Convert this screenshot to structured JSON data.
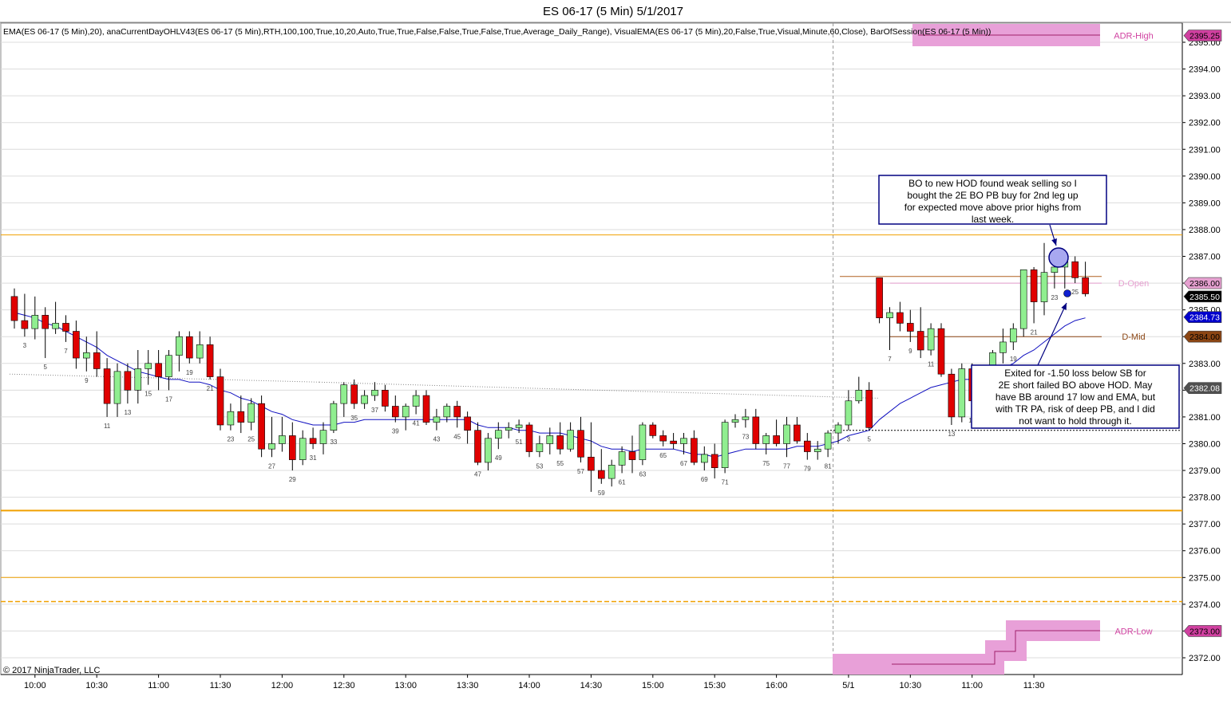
{
  "chart_data": {
    "type": "candlestick",
    "title": "ES 06-17 (5 Min)  5/1/2017",
    "indicator_line": "EMA(ES 06-17 (5 Min),20), anaCurrentDayOHLV43(ES 06-17 (5 Min),RTH,100,100,True,10,20,Auto,True,True,False,False,True,False,True,Average_Daily_Range), VisualEMA(ES 06-17 (5 Min),20,False,True,Visual,Minute,60,Close), BarOfSession(ES 06-17 (5 Min))",
    "copyright": "© 2017 NinjaTrader, LLC",
    "ylim": [
      2371.4,
      2395.5
    ],
    "y_ticks": [
      "2372.00",
      "2373.00",
      "2374.00",
      "2375.00",
      "2376.00",
      "2377.00",
      "2378.00",
      "2379.00",
      "2380.00",
      "2381.00",
      "2382.00",
      "2383.00",
      "2384.00",
      "2385.00",
      "2386.00",
      "2387.00",
      "2388.00",
      "2389.00",
      "2390.00",
      "2391.00",
      "2392.00",
      "2393.00",
      "2394.00",
      "2395.00"
    ],
    "x_ticks": [
      "10:00",
      "10:30",
      "11:00",
      "11:30",
      "12:00",
      "12:30",
      "13:00",
      "13:30",
      "14:00",
      "14:30",
      "15:00",
      "15:30",
      "16:00",
      "5/1",
      "10:30",
      "11:00",
      "11:30"
    ],
    "x_tick_bars": [
      2,
      8,
      14,
      20,
      26,
      32,
      38,
      44,
      50,
      56,
      62,
      68,
      74,
      81,
      87,
      93,
      99
    ],
    "session_break_bar": 79.5,
    "bar_count": 105,
    "candles": [
      [
        2385.5,
        2385.8,
        2384.3,
        2384.6
      ],
      [
        2384.6,
        2385.6,
        2384.0,
        2384.3
      ],
      [
        2384.3,
        2385.5,
        2383.9,
        2384.8
      ],
      [
        2384.8,
        2385.1,
        2383.2,
        2384.3
      ],
      [
        2384.3,
        2385.3,
        2384.1,
        2384.5
      ],
      [
        2384.5,
        2384.8,
        2383.8,
        2384.2
      ],
      [
        2384.2,
        2384.6,
        2382.8,
        2383.2
      ],
      [
        2383.2,
        2384.0,
        2382.7,
        2383.4
      ],
      [
        2383.4,
        2384.2,
        2382.5,
        2382.8
      ],
      [
        2382.8,
        2383.2,
        2381.0,
        2381.5
      ],
      [
        2381.5,
        2383.0,
        2381.0,
        2382.7
      ],
      [
        2382.7,
        2383.0,
        2381.5,
        2382.0
      ],
      [
        2382.0,
        2383.5,
        2381.5,
        2382.8
      ],
      [
        2382.8,
        2383.5,
        2382.2,
        2383.0
      ],
      [
        2383.0,
        2383.5,
        2382.0,
        2382.5
      ],
      [
        2382.5,
        2383.5,
        2382.0,
        2383.3
      ],
      [
        2383.3,
        2384.2,
        2382.7,
        2384.0
      ],
      [
        2384.0,
        2384.2,
        2383.0,
        2383.2
      ],
      [
        2383.2,
        2384.2,
        2383.0,
        2383.7
      ],
      [
        2383.7,
        2384.0,
        2382.4,
        2382.5
      ],
      [
        2382.5,
        2382.8,
        2380.5,
        2380.7
      ],
      [
        2380.7,
        2381.5,
        2380.5,
        2381.2
      ],
      [
        2381.2,
        2381.8,
        2380.4,
        2380.8
      ],
      [
        2380.8,
        2381.7,
        2380.5,
        2381.5
      ],
      [
        2381.5,
        2381.8,
        2379.5,
        2379.8
      ],
      [
        2379.8,
        2381.0,
        2379.5,
        2380.0
      ],
      [
        2380.0,
        2381.0,
        2379.7,
        2380.3
      ],
      [
        2380.3,
        2380.8,
        2379.0,
        2379.4
      ],
      [
        2379.4,
        2380.5,
        2379.2,
        2380.2
      ],
      [
        2380.2,
        2380.6,
        2379.8,
        2380.0
      ],
      [
        2380.0,
        2380.8,
        2379.6,
        2380.5
      ],
      [
        2380.5,
        2381.6,
        2380.4,
        2381.5
      ],
      [
        2381.5,
        2382.3,
        2381.0,
        2382.2
      ],
      [
        2382.2,
        2382.4,
        2381.3,
        2381.5
      ],
      [
        2381.5,
        2382.0,
        2381.3,
        2381.8
      ],
      [
        2381.8,
        2382.3,
        2381.6,
        2382.0
      ],
      [
        2382.0,
        2382.2,
        2381.2,
        2381.4
      ],
      [
        2381.4,
        2381.8,
        2380.8,
        2381.0
      ],
      [
        2381.0,
        2381.5,
        2380.5,
        2381.4
      ],
      [
        2381.4,
        2382.0,
        2381.1,
        2381.8
      ],
      [
        2381.8,
        2382.0,
        2380.7,
        2380.8
      ],
      [
        2380.8,
        2381.3,
        2380.5,
        2381.0
      ],
      [
        2381.0,
        2381.5,
        2380.8,
        2381.4
      ],
      [
        2381.4,
        2381.6,
        2380.6,
        2381.0
      ],
      [
        2381.0,
        2381.2,
        2380.0,
        2380.5
      ],
      [
        2380.5,
        2380.8,
        2379.2,
        2379.3
      ],
      [
        2379.3,
        2380.4,
        2379.0,
        2380.2
      ],
      [
        2380.2,
        2380.8,
        2379.8,
        2380.5
      ],
      [
        2380.5,
        2380.8,
        2380.2,
        2380.6
      ],
      [
        2380.6,
        2380.9,
        2380.4,
        2380.7
      ],
      [
        2380.7,
        2380.8,
        2379.5,
        2379.7
      ],
      [
        2379.7,
        2380.3,
        2379.5,
        2380.0
      ],
      [
        2380.0,
        2380.6,
        2379.6,
        2380.3
      ],
      [
        2380.3,
        2380.8,
        2379.6,
        2379.8
      ],
      [
        2379.8,
        2380.8,
        2379.7,
        2380.5
      ],
      [
        2380.5,
        2381.0,
        2379.3,
        2379.5
      ],
      [
        2379.5,
        2380.8,
        2378.2,
        2379.0
      ],
      [
        2379.0,
        2379.8,
        2378.5,
        2378.7
      ],
      [
        2378.7,
        2379.4,
        2378.4,
        2379.2
      ],
      [
        2379.2,
        2379.9,
        2378.9,
        2379.7
      ],
      [
        2379.7,
        2380.3,
        2378.9,
        2379.4
      ],
      [
        2379.4,
        2380.8,
        2379.2,
        2380.7
      ],
      [
        2380.7,
        2380.8,
        2380.2,
        2380.3
      ],
      [
        2380.3,
        2380.5,
        2379.9,
        2380.1
      ],
      [
        2380.1,
        2380.4,
        2379.8,
        2380.0
      ],
      [
        2380.0,
        2380.4,
        2379.6,
        2380.2
      ],
      [
        2380.2,
        2380.5,
        2379.2,
        2379.3
      ],
      [
        2379.3,
        2379.9,
        2379.0,
        2379.6
      ],
      [
        2379.6,
        2380.0,
        2378.7,
        2379.1
      ],
      [
        2379.1,
        2380.9,
        2378.9,
        2380.8
      ],
      [
        2380.8,
        2381.1,
        2380.6,
        2380.9
      ],
      [
        2380.9,
        2381.3,
        2380.6,
        2381.0
      ],
      [
        2381.0,
        2381.3,
        2379.8,
        2380.0
      ],
      [
        2380.0,
        2380.4,
        2379.6,
        2380.3
      ],
      [
        2380.3,
        2380.9,
        2379.9,
        2380.0
      ],
      [
        2380.0,
        2381.0,
        2379.5,
        2380.7
      ],
      [
        2380.7,
        2381.0,
        2380.0,
        2380.1
      ],
      [
        2380.1,
        2380.4,
        2379.4,
        2379.7
      ],
      [
        2379.7,
        2380.1,
        2379.4,
        2379.8
      ],
      [
        2379.8,
        2380.5,
        2379.5,
        2380.4
      ],
      [
        2380.4,
        2380.8,
        2380.0,
        2380.7
      ],
      [
        2380.7,
        2382.0,
        2380.5,
        2381.6
      ],
      [
        2381.6,
        2382.5,
        2381.5,
        2382.0
      ],
      [
        2382.0,
        2382.3,
        2380.5,
        2380.6
      ],
      [
        2386.2,
        2386.2,
        2384.5,
        2384.7
      ],
      [
        2384.7,
        2385.1,
        2383.5,
        2384.9
      ],
      [
        2384.9,
        2385.3,
        2384.2,
        2384.5
      ],
      [
        2384.5,
        2385.0,
        2383.8,
        2384.2
      ],
      [
        2384.2,
        2385.1,
        2383.2,
        2383.5
      ],
      [
        2383.5,
        2384.5,
        2383.3,
        2384.3
      ],
      [
        2384.3,
        2384.5,
        2382.5,
        2382.6
      ],
      [
        2382.6,
        2382.8,
        2380.7,
        2381.0
      ],
      [
        2381.0,
        2383.0,
        2380.8,
        2382.8
      ],
      [
        2382.8,
        2383.0,
        2381.2,
        2381.6
      ],
      [
        2381.6,
        2382.6,
        2381.0,
        2382.2
      ],
      [
        2382.2,
        2383.5,
        2382.0,
        2383.4
      ],
      [
        2383.4,
        2384.3,
        2383.0,
        2383.8
      ],
      [
        2383.8,
        2384.5,
        2383.5,
        2384.3
      ],
      [
        2384.3,
        2385.8,
        2384.0,
        2386.5
      ],
      [
        2386.5,
        2386.6,
        2384.5,
        2385.3
      ],
      [
        2385.3,
        2387.5,
        2384.8,
        2386.4
      ],
      [
        2386.4,
        2387.2,
        2385.8,
        2386.6
      ],
      [
        2386.6,
        2387.1,
        2385.8,
        2386.8
      ],
      [
        2386.8,
        2387.0,
        2386.0,
        2386.2
      ],
      [
        2386.2,
        2386.8,
        2385.5,
        2385.6
      ]
    ],
    "bar_numbers": [
      {
        "bar": 1,
        "label": "3"
      },
      {
        "bar": 3,
        "label": "5"
      },
      {
        "bar": 5,
        "label": "7"
      },
      {
        "bar": 7,
        "label": "9"
      },
      {
        "bar": 9,
        "label": "11"
      },
      {
        "bar": 11,
        "label": "13"
      },
      {
        "bar": 13,
        "label": "15"
      },
      {
        "bar": 15,
        "label": "17"
      },
      {
        "bar": 17,
        "label": "19"
      },
      {
        "bar": 19,
        "label": "21"
      },
      {
        "bar": 21,
        "label": "23"
      },
      {
        "bar": 23,
        "label": "25"
      },
      {
        "bar": 25,
        "label": "27"
      },
      {
        "bar": 27,
        "label": "29"
      },
      {
        "bar": 29,
        "label": "31"
      },
      {
        "bar": 31,
        "label": "33"
      },
      {
        "bar": 33,
        "label": "35"
      },
      {
        "bar": 35,
        "label": "37"
      },
      {
        "bar": 37,
        "label": "39"
      },
      {
        "bar": 39,
        "label": "41"
      },
      {
        "bar": 41,
        "label": "43"
      },
      {
        "bar": 43,
        "label": "45"
      },
      {
        "bar": 45,
        "label": "47"
      },
      {
        "bar": 47,
        "label": "49"
      },
      {
        "bar": 49,
        "label": "51"
      },
      {
        "bar": 51,
        "label": "53"
      },
      {
        "bar": 53,
        "label": "55"
      },
      {
        "bar": 55,
        "label": "57"
      },
      {
        "bar": 57,
        "label": "59"
      },
      {
        "bar": 59,
        "label": "61"
      },
      {
        "bar": 61,
        "label": "63"
      },
      {
        "bar": 63,
        "label": "65"
      },
      {
        "bar": 65,
        "label": "67"
      },
      {
        "bar": 67,
        "label": "69"
      },
      {
        "bar": 69,
        "label": "71"
      },
      {
        "bar": 71,
        "label": "73"
      },
      {
        "bar": 73,
        "label": "75"
      },
      {
        "bar": 75,
        "label": "77"
      },
      {
        "bar": 77,
        "label": "79"
      },
      {
        "bar": 79,
        "label": "81"
      },
      {
        "bar": 81,
        "label": "3"
      },
      {
        "bar": 83,
        "label": "5"
      },
      {
        "bar": 85,
        "label": "7"
      },
      {
        "bar": 87,
        "label": "9"
      },
      {
        "bar": 89,
        "label": "11"
      },
      {
        "bar": 91,
        "label": "13"
      },
      {
        "bar": 93,
        "label": "15"
      },
      {
        "bar": 95,
        "label": "17"
      },
      {
        "bar": 97,
        "label": "19"
      },
      {
        "bar": 99,
        "label": "21"
      },
      {
        "bar": 101,
        "label": "23"
      },
      {
        "bar": 103,
        "label": "25"
      }
    ],
    "ema": [
      2384.9,
      2384.8,
      2384.7,
      2384.5,
      2384.4,
      2384.2,
      2384.0,
      2383.8,
      2383.6,
      2383.3,
      2383.1,
      2382.9,
      2382.7,
      2382.6,
      2382.5,
      2382.4,
      2382.4,
      2382.3,
      2382.3,
      2382.2,
      2382.0,
      2381.9,
      2381.7,
      2381.6,
      2381.4,
      2381.2,
      2381.1,
      2380.9,
      2380.8,
      2380.7,
      2380.7,
      2380.7,
      2380.8,
      2380.8,
      2380.9,
      2380.9,
      2380.9,
      2380.9,
      2380.9,
      2380.9,
      2380.9,
      2380.9,
      2380.9,
      2380.9,
      2380.9,
      2380.7,
      2380.6,
      2380.6,
      2380.6,
      2380.5,
      2380.5,
      2380.4,
      2380.4,
      2380.4,
      2380.3,
      2380.2,
      2380.1,
      2379.9,
      2379.8,
      2379.8,
      2379.7,
      2379.8,
      2379.8,
      2379.8,
      2379.8,
      2379.7,
      2379.6,
      2379.6,
      2379.5,
      2379.6,
      2379.7,
      2379.8,
      2379.8,
      2379.8,
      2379.8,
      2379.8,
      2379.9,
      2379.9,
      2379.9,
      2380.0,
      2380.1,
      2380.3,
      2380.4,
      2380.5,
      2380.9,
      2381.2,
      2381.5,
      2381.7,
      2381.9,
      2382.1,
      2382.2,
      2382.3,
      2382.4,
      2382.4,
      2382.5,
      2382.7,
      2382.8,
      2383.0,
      2383.3,
      2383.5,
      2383.8,
      2384.1,
      2384.4,
      2384.6,
      2384.7
    ],
    "levels": {
      "orange_upper": 2387.8,
      "orange_lower": 2377.5,
      "orange_thin": 2375.0,
      "orange_dashed": 2374.1
    },
    "day_levels": [
      {
        "label": "D-Open",
        "value": 2386.0,
        "tag": "2386.00",
        "color": "#e6a0d0"
      },
      {
        "label": "D-Mid",
        "value": 2384.0,
        "tag": "2384.00",
        "color": "#8b4513"
      },
      {
        "label": "ADR-High",
        "value": 2395.25,
        "tag": "2395.25",
        "color": "#d040a0"
      },
      {
        "label": "ADR-Low",
        "value": 2373.0,
        "tag": "2373.00",
        "color": "#d040a0"
      }
    ],
    "price_tags": [
      {
        "value": 2385.5,
        "text": "2385.50",
        "bg": "#000000",
        "fg": "#ffffff"
      },
      {
        "value": 2384.73,
        "text": "2384.73",
        "bg": "#0000cc",
        "fg": "#ffffff"
      },
      {
        "value": 2382.08,
        "text": "2382.08",
        "bg": "#505050",
        "fg": "#ffffff"
      }
    ],
    "annotations": [
      {
        "text_lines": [
          "BO to new HOD found weak selling so I",
          "bought the 2E BO PB buy for 2nd leg up",
          "for expected move above prior highs from",
          "last week."
        ]
      },
      {
        "text_lines": [
          "Exited for -1.50 loss below SB for",
          "2E short failed BO above HOD.  May",
          "have BB around 17 low and EMA, but",
          "with TR PA, risk of deep PB, and I did",
          "not want to hold through it."
        ]
      }
    ],
    "colors": {
      "up": "#90ee90",
      "down": "#e00000",
      "ema": "#1010c0",
      "grid": "#dcdcdc",
      "level": "#f0a000",
      "adr": "#e8a0d8",
      "box": "#000080"
    }
  }
}
